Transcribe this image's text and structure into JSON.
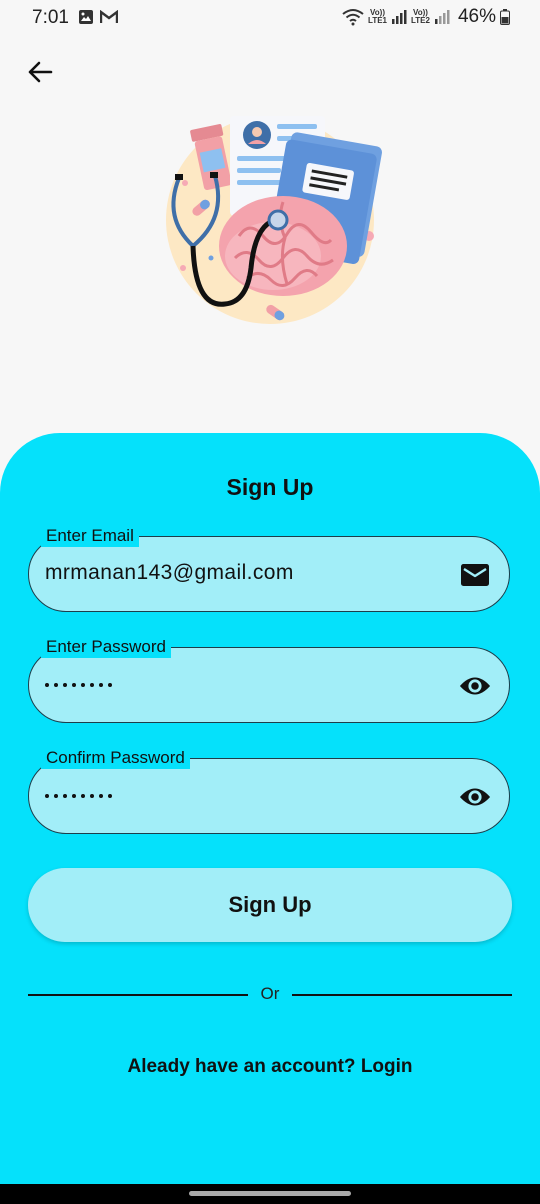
{
  "status_bar": {
    "time": "7:01",
    "sim1": "LTE1",
    "sim2": "LTE2",
    "volte": "Vo))",
    "battery": "46%"
  },
  "header": {
    "back_icon": "arrow-left-icon"
  },
  "form": {
    "title": "Sign Up",
    "email": {
      "label": "Enter Email",
      "value": "mrmanan143@gmail.com",
      "icon": "mail-icon"
    },
    "password": {
      "label": "Enter Password",
      "masked_length": 8,
      "icon": "eye-icon"
    },
    "confirm_password": {
      "label": "Confirm Password",
      "masked_length": 8,
      "icon": "eye-icon"
    },
    "submit_label": "Sign Up",
    "or_text": "Or",
    "login_prompt": "Aleady have an account? Login"
  },
  "colors": {
    "panel": "#05e1fb",
    "field_fill": "#a2eef8",
    "background": "#f7f7f7"
  }
}
